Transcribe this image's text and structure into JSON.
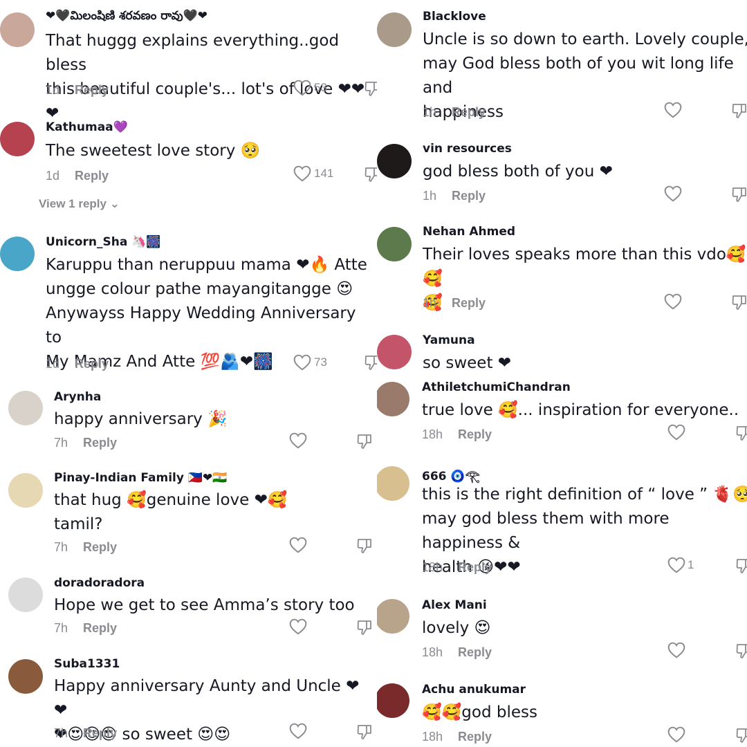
{
  "left": [
    {
      "user": "❤🖤మిలంషిణి శరవణం రావు🖤❤",
      "text": "That huggg explains everything..god bless\nthis beautiful couple's... lot's of love ❤❤❤",
      "time": "1d",
      "reply": "Reply",
      "likes": "53",
      "avatar_color": "#c9a79b"
    },
    {
      "user": "Kathumaa💜",
      "text": "The sweetest love story 🥺",
      "time": "1d",
      "reply": "Reply",
      "likes": "141",
      "view_replies": "View 1 reply",
      "avatar_color": "#b5424e"
    },
    {
      "user": "Unicorn_Sha 🦄🎆",
      "text": "Karuppu than neruppuu mama ❤🔥 Atte\nungge colour pathe mayangitangge 😍\nAnywayss Happy Wedding Anniversary to\nMy Mamz And Atte 💯🫂❤🎆",
      "time": "1d",
      "reply": "Reply",
      "likes": "73",
      "avatar_color": "#4aa6c9"
    },
    {
      "user": "Arynha",
      "text": "happy anniversary 🎉",
      "time": "7h",
      "reply": "Reply",
      "likes": "",
      "avatar_color": "#d9d2cb"
    },
    {
      "user": "Pinay-Indian Family 🇵🇭❤🇮🇳",
      "text": "that hug 🥰genuine love ❤🥰\ntamil?",
      "time": "7h",
      "reply": "Reply",
      "likes": "",
      "avatar_color": "#e7d8b4"
    },
    {
      "user": "doradoradora",
      "text": "Hope we get to see Amma’s story too",
      "time": "7h",
      "reply": "Reply",
      "likes": "",
      "avatar_color": "#dcdcdc"
    },
    {
      "user": "Suba1331",
      "text": "Happy anniversary Aunty and Uncle ❤❤\n❤😍😍😍 so sweet 😍😍",
      "time": "7h",
      "reply": "Reply",
      "likes": "",
      "avatar_color": "#8a5a3c"
    }
  ],
  "right": [
    {
      "user": "Blacklove",
      "text": "Uncle is so down to earth. Lovely couple,\nmay God bless both of you wit long life and\nhappiness",
      "time": "1h",
      "reply": "Reply",
      "likes": "",
      "avatar_color": "#a99a8a"
    },
    {
      "user": "vin resources",
      "text": "god bless both of you ❤",
      "time": "1h",
      "reply": "Reply",
      "likes": "",
      "avatar_color": "#1e1a1a"
    },
    {
      "user": "Nehan Ahmed",
      "text": "Their loves speaks more than this vdo🥰🥰\n🥰",
      "time": "1h",
      "reply": "Reply",
      "likes": "",
      "avatar_color": "#5d7a4c"
    },
    {
      "user": "Yamuna",
      "text": "so sweet ❤",
      "time": "",
      "reply": "",
      "likes": "",
      "avatar_color": "#c4546a"
    },
    {
      "user": "AthiletchumiChandran",
      "text": "true love 🥰... inspiration for everyone..",
      "time": "18h",
      "reply": "Reply",
      "likes": "",
      "avatar_color": "#9a7a6a"
    },
    {
      "user": "666 🧿𓂀",
      "text": "this is the right definition of “ love ” 🫀🥺\nmay god bless them with more happiness &\nhealth 😘❤❤",
      "time": "18h",
      "reply": "Reply",
      "likes": "1",
      "avatar_color": "#d8bf8f"
    },
    {
      "user": "Alex Mani",
      "text": "lovely 😍",
      "time": "18h",
      "reply": "Reply",
      "likes": "",
      "avatar_color": "#b8a48a"
    },
    {
      "user": "Achu anukumar",
      "text": "🥰🥰god bless",
      "time": "18h",
      "reply": "Reply",
      "likes": "",
      "avatar_color": "#7a2a2a"
    }
  ],
  "icons": {
    "like": "heart-outline-icon",
    "dislike": "thumbs-down-icon"
  }
}
